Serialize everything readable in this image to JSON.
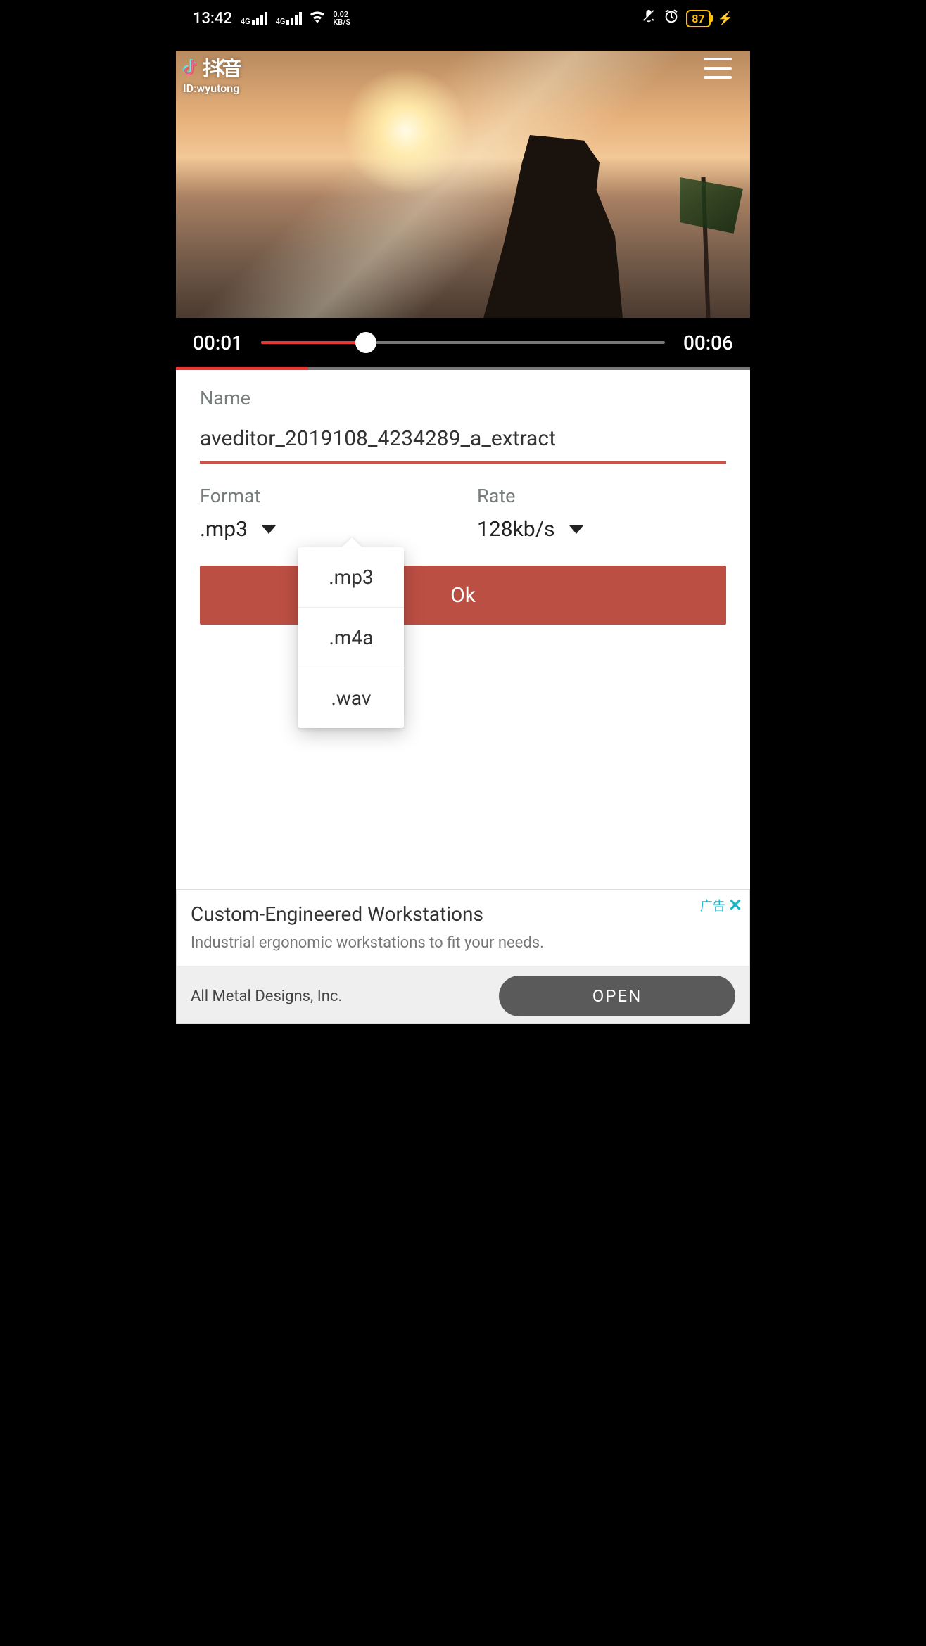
{
  "status": {
    "time": "13:42",
    "network_label": "4G",
    "net_rate_top": "0.02",
    "net_rate_bottom": "KB/S",
    "battery": "87"
  },
  "video": {
    "watermark_app": "抖音",
    "watermark_id": "ID:wyutong",
    "current_time": "00:01",
    "duration": "00:06"
  },
  "form": {
    "name_label": "Name",
    "name_value": "aveditor_2019108_4234289_a_extract",
    "format_label": "Format",
    "format_value": ".mp3",
    "rate_label": "Rate",
    "rate_value": "128kb/s",
    "ok_label": "Ok"
  },
  "format_options": [
    ".mp3",
    ".m4a",
    ".wav"
  ],
  "ad": {
    "title": "Custom-Engineered Workstations",
    "subtitle": "Industrial ergonomic workstations to fit your needs.",
    "badge": "广告",
    "company": "All Metal Designs, Inc.",
    "cta": "OPEN"
  }
}
